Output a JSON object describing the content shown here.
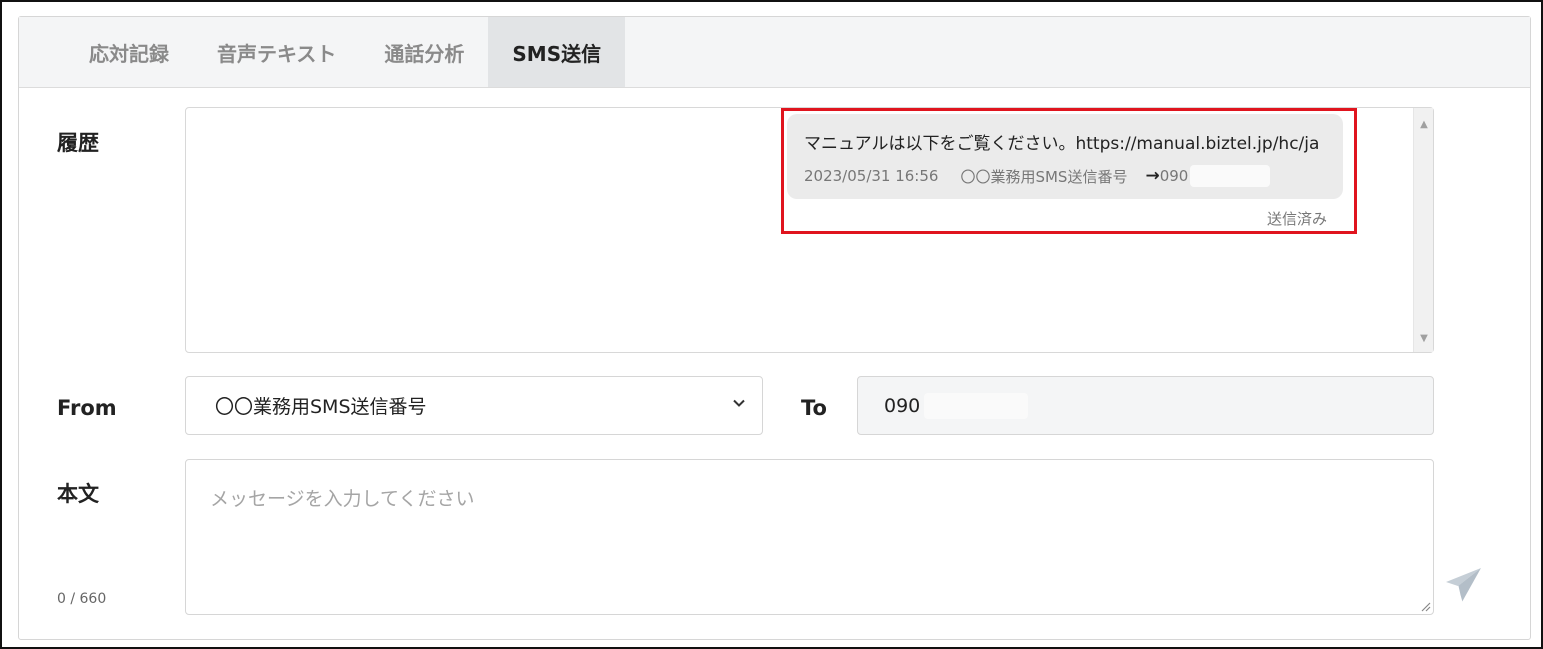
{
  "tabs": [
    {
      "label": "応対記録"
    },
    {
      "label": "音声テキスト"
    },
    {
      "label": "通話分析"
    },
    {
      "label": "SMS送信"
    }
  ],
  "history": {
    "label": "履歴",
    "message": {
      "text": "マニュアルは以下をご覧ください。https://manual.biztel.jp/hc/ja",
      "timestamp": "2023/05/31 16:56",
      "sender": "〇〇業務用SMS送信番号",
      "arrow": "→",
      "recipient": "090",
      "status": "送信済み"
    }
  },
  "from": {
    "label": "From",
    "selected": "〇〇業務用SMS送信番号"
  },
  "to": {
    "label": "To",
    "value": "090"
  },
  "body": {
    "label": "本文",
    "placeholder": "メッセージを入力してください",
    "counter": "0 / 660"
  },
  "colors": {
    "highlight": "#e0141e",
    "active_tab_bg": "#e2e4e6",
    "send_icon": "#c5ced6"
  }
}
